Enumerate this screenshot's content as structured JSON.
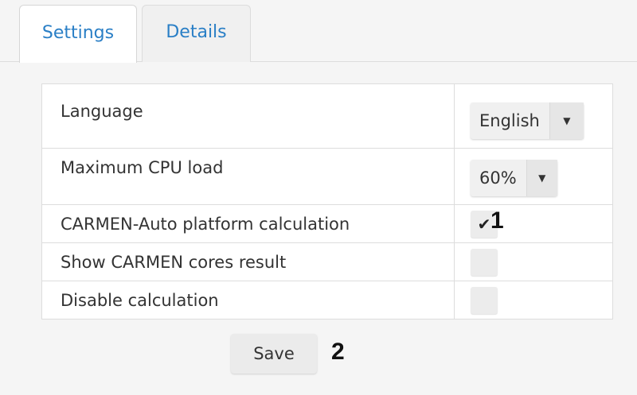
{
  "tabs": [
    {
      "label": "Settings",
      "active": true
    },
    {
      "label": "Details",
      "active": false
    }
  ],
  "settings": {
    "rows": [
      {
        "label": "Language",
        "control": "select",
        "value": "English"
      },
      {
        "label": "Maximum CPU load",
        "control": "select",
        "value": "60%"
      },
      {
        "label": "CARMEN-Auto platform calculation",
        "control": "checkbox",
        "checked": true
      },
      {
        "label": "Show CARMEN cores result",
        "control": "checkbox",
        "checked": false
      },
      {
        "label": "Disable calculation",
        "control": "checkbox",
        "checked": false
      }
    ]
  },
  "save_label": "Save",
  "annotations": {
    "checkbox_marker": "1",
    "save_marker": "2"
  },
  "icons": {
    "dropdown": "caret-down-icon",
    "check": "check-icon"
  },
  "colors": {
    "tab_text": "#2a7fc6",
    "background": "#f5f5f5",
    "border": "#dddddd"
  }
}
